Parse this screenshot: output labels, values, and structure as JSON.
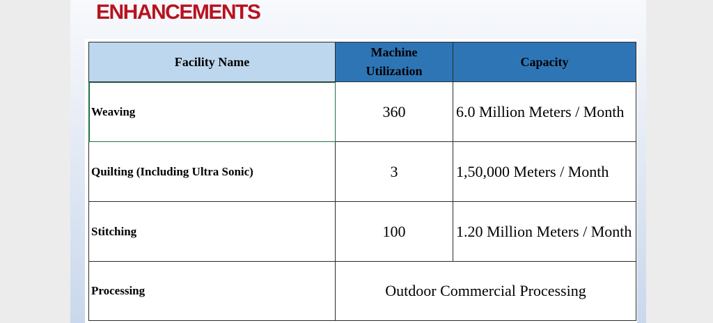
{
  "slide": {
    "title": "ENHANCEMENTS"
  },
  "table": {
    "headers": {
      "facility": "Facility Name",
      "utilization_line1": "Machine",
      "utilization_line2": "Utilization",
      "capacity": "Capacity"
    },
    "rows": [
      {
        "facility": "Weaving",
        "utilization": "360",
        "capacity": "6.0 Million Meters / Month"
      },
      {
        "facility": "Quilting (Including Ultra Sonic)",
        "utilization": "3",
        "capacity": "1,50,000 Meters / Month"
      },
      {
        "facility": "Stitching",
        "utilization": "100",
        "capacity": "1.20 Million Meters / Month"
      },
      {
        "facility": "Processing",
        "merged_value": "Outdoor Commercial Processing"
      }
    ]
  },
  "colors": {
    "title": "#b8121f",
    "header_light": "#bdd7ee",
    "header_dark": "#2e75b6",
    "selection": "#217346"
  }
}
